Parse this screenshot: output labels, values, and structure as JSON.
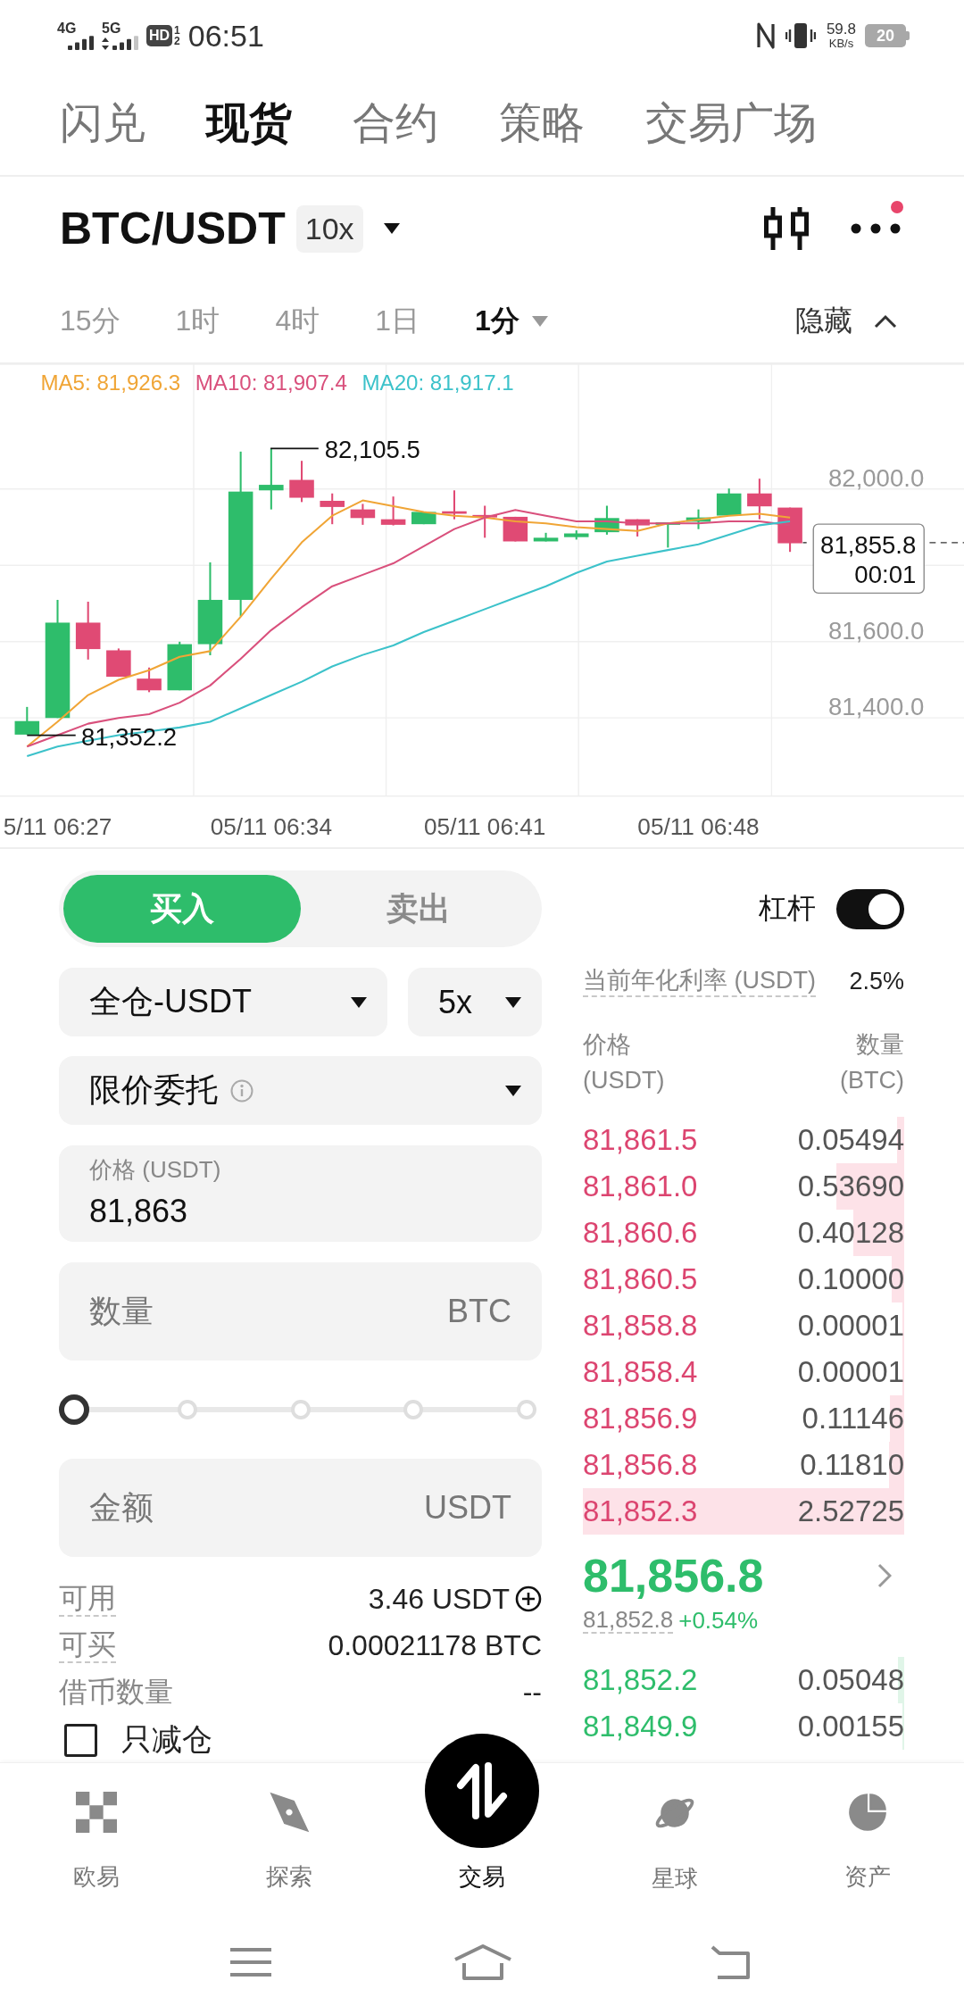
{
  "status_bar": {
    "network_1": "4G",
    "network_2": "5G",
    "hd": "HD",
    "sim_1": "1",
    "sim_2": "2",
    "time": "06:51",
    "speed": "59.8",
    "speed_unit": "KB/s",
    "battery": "20"
  },
  "top_tabs": [
    {
      "label": "闪兑",
      "selected": false
    },
    {
      "label": "现货",
      "selected": true
    },
    {
      "label": "合约",
      "selected": false
    },
    {
      "label": "策略",
      "selected": false
    },
    {
      "label": "交易广场",
      "selected": false
    }
  ],
  "pair_header": {
    "pair": "BTC/USDT",
    "leverage": "10x",
    "has_notification": true
  },
  "timeframes": [
    {
      "label": "15分",
      "selected": false,
      "kind": "preset"
    },
    {
      "label": "1时",
      "selected": false,
      "kind": "preset"
    },
    {
      "label": "4时",
      "selected": false,
      "kind": "preset"
    },
    {
      "label": "1日",
      "selected": false,
      "kind": "preset"
    },
    {
      "label": "1分",
      "selected": true,
      "kind": "menu"
    }
  ],
  "chart_toggle": {
    "label": "隐藏",
    "expanded": true
  },
  "chart": {
    "chart_data": {
      "type": "line",
      "grid": true,
      "categories": [
        null,
        "5/11 06:27",
        null,
        null,
        null,
        null,
        null,
        null,
        "05/11 06:34",
        null,
        null,
        null,
        null,
        null,
        null,
        "05/11 06:41",
        null,
        null,
        null,
        null,
        null,
        null,
        "05/11 06:48",
        null,
        null,
        null
      ],
      "ylim": [
        81195,
        82327
      ],
      "yticks": [
        {
          "value": 81400,
          "label": "81,400.0"
        },
        {
          "value": 81600,
          "label": "81,600.0"
        },
        {
          "value": 82000,
          "label": "82,000.0"
        }
      ],
      "series": [
        {
          "name": "MA5: 81,926.3",
          "color": "#f0a536",
          "values": [
            81325,
            81390,
            81460,
            81500,
            81525,
            81560,
            81575,
            81665,
            81765,
            81860,
            81930,
            81970,
            81955,
            81940,
            81930,
            81925,
            81915,
            81910,
            81900,
            81895,
            81890,
            81910,
            81920,
            81930,
            81935,
            81925
          ]
        },
        {
          "name": "MA10: 81,907.4",
          "color": "#d9507c",
          "values": [
            81325,
            81355,
            81385,
            81400,
            81410,
            81440,
            81485,
            81555,
            81630,
            81690,
            81745,
            81775,
            81805,
            81850,
            81895,
            81925,
            81945,
            81930,
            81915,
            81915,
            81910,
            81910,
            81910,
            81915,
            81915,
            81905
          ]
        },
        {
          "name": "MA20: 81,917.1",
          "color": "#3cc2ca",
          "values": [
            81300,
            81325,
            81340,
            81355,
            81365,
            81375,
            81390,
            81425,
            81460,
            81495,
            81535,
            81565,
            81590,
            81625,
            81655,
            81685,
            81715,
            81745,
            81780,
            81810,
            81825,
            81840,
            81855,
            81880,
            81905,
            81915
          ]
        }
      ]
    },
    "high_label": "82,105.5",
    "low_label": "81,352.2",
    "price_tag": {
      "price": "81,855.8",
      "countdown": "00:01"
    }
  },
  "order_form": {
    "sides": [
      {
        "label": "买入",
        "selected": true
      },
      {
        "label": "卖出",
        "selected": false
      }
    ],
    "leverage": {
      "label": "杠杆",
      "on": true
    },
    "margin_mode": "全仓-USDT",
    "multiplier": "5x",
    "order_type": "限价委托",
    "price": {
      "label": "价格 (USDT)",
      "value": "81,863"
    },
    "quantity": {
      "placeholder": "数量",
      "unit": "BTC"
    },
    "slider": {
      "level": 0
    },
    "amount": {
      "placeholder": "金额",
      "unit": "USDT"
    },
    "info": [
      {
        "label": "可用",
        "value": "3.46 USDT",
        "underlined": true,
        "kind": "balance"
      },
      {
        "label": "可买",
        "value": "0.00021178 BTC",
        "underlined": true,
        "kind": "plain"
      },
      {
        "label": "借币数量",
        "value": "--",
        "underlined": false,
        "kind": "plain"
      }
    ],
    "reduce_only": {
      "label": "只减仓",
      "checked": false
    }
  },
  "order_book": {
    "rate_label": "当前年化利率 (USDT)",
    "rate_value": "2.5%",
    "price_header": "价格",
    "price_unit": "(USDT)",
    "amount_header": "数量",
    "amount_unit": "(BTC)",
    "asks": [
      {
        "price": "81,861.5",
        "amount": "0.05494",
        "level": 0.022
      },
      {
        "price": "81,861.0",
        "amount": "0.53690",
        "level": 0.212
      },
      {
        "price": "81,860.6",
        "amount": "0.40128",
        "level": 0.159
      },
      {
        "price": "81,860.5",
        "amount": "0.10000",
        "level": 0.04
      },
      {
        "price": "81,858.8",
        "amount": "0.00001",
        "level": 0.006
      },
      {
        "price": "81,858.4",
        "amount": "0.00001",
        "level": 0.006
      },
      {
        "price": "81,856.9",
        "amount": "0.11146",
        "level": 0.044
      },
      {
        "price": "81,856.8",
        "amount": "0.11810",
        "level": 0.047
      },
      {
        "price": "81,852.3",
        "amount": "2.52725",
        "level": 1
      }
    ],
    "last_price": "81,856.8",
    "mark_price": "81,852.8",
    "change": "+0.54%",
    "bids": [
      {
        "price": "81,852.2",
        "amount": "0.05048",
        "level": 0.02
      },
      {
        "price": "81,849.9",
        "amount": "0.00155",
        "level": 0.006
      }
    ]
  },
  "bottom_nav": [
    {
      "label": "欧易",
      "selected": false,
      "kind": "tab"
    },
    {
      "label": "探索",
      "selected": false,
      "kind": "tab"
    },
    {
      "label": "交易",
      "selected": true,
      "kind": "center"
    },
    {
      "label": "星球",
      "selected": false,
      "kind": "tab"
    },
    {
      "label": "资产",
      "selected": false,
      "kind": "tab"
    }
  ]
}
